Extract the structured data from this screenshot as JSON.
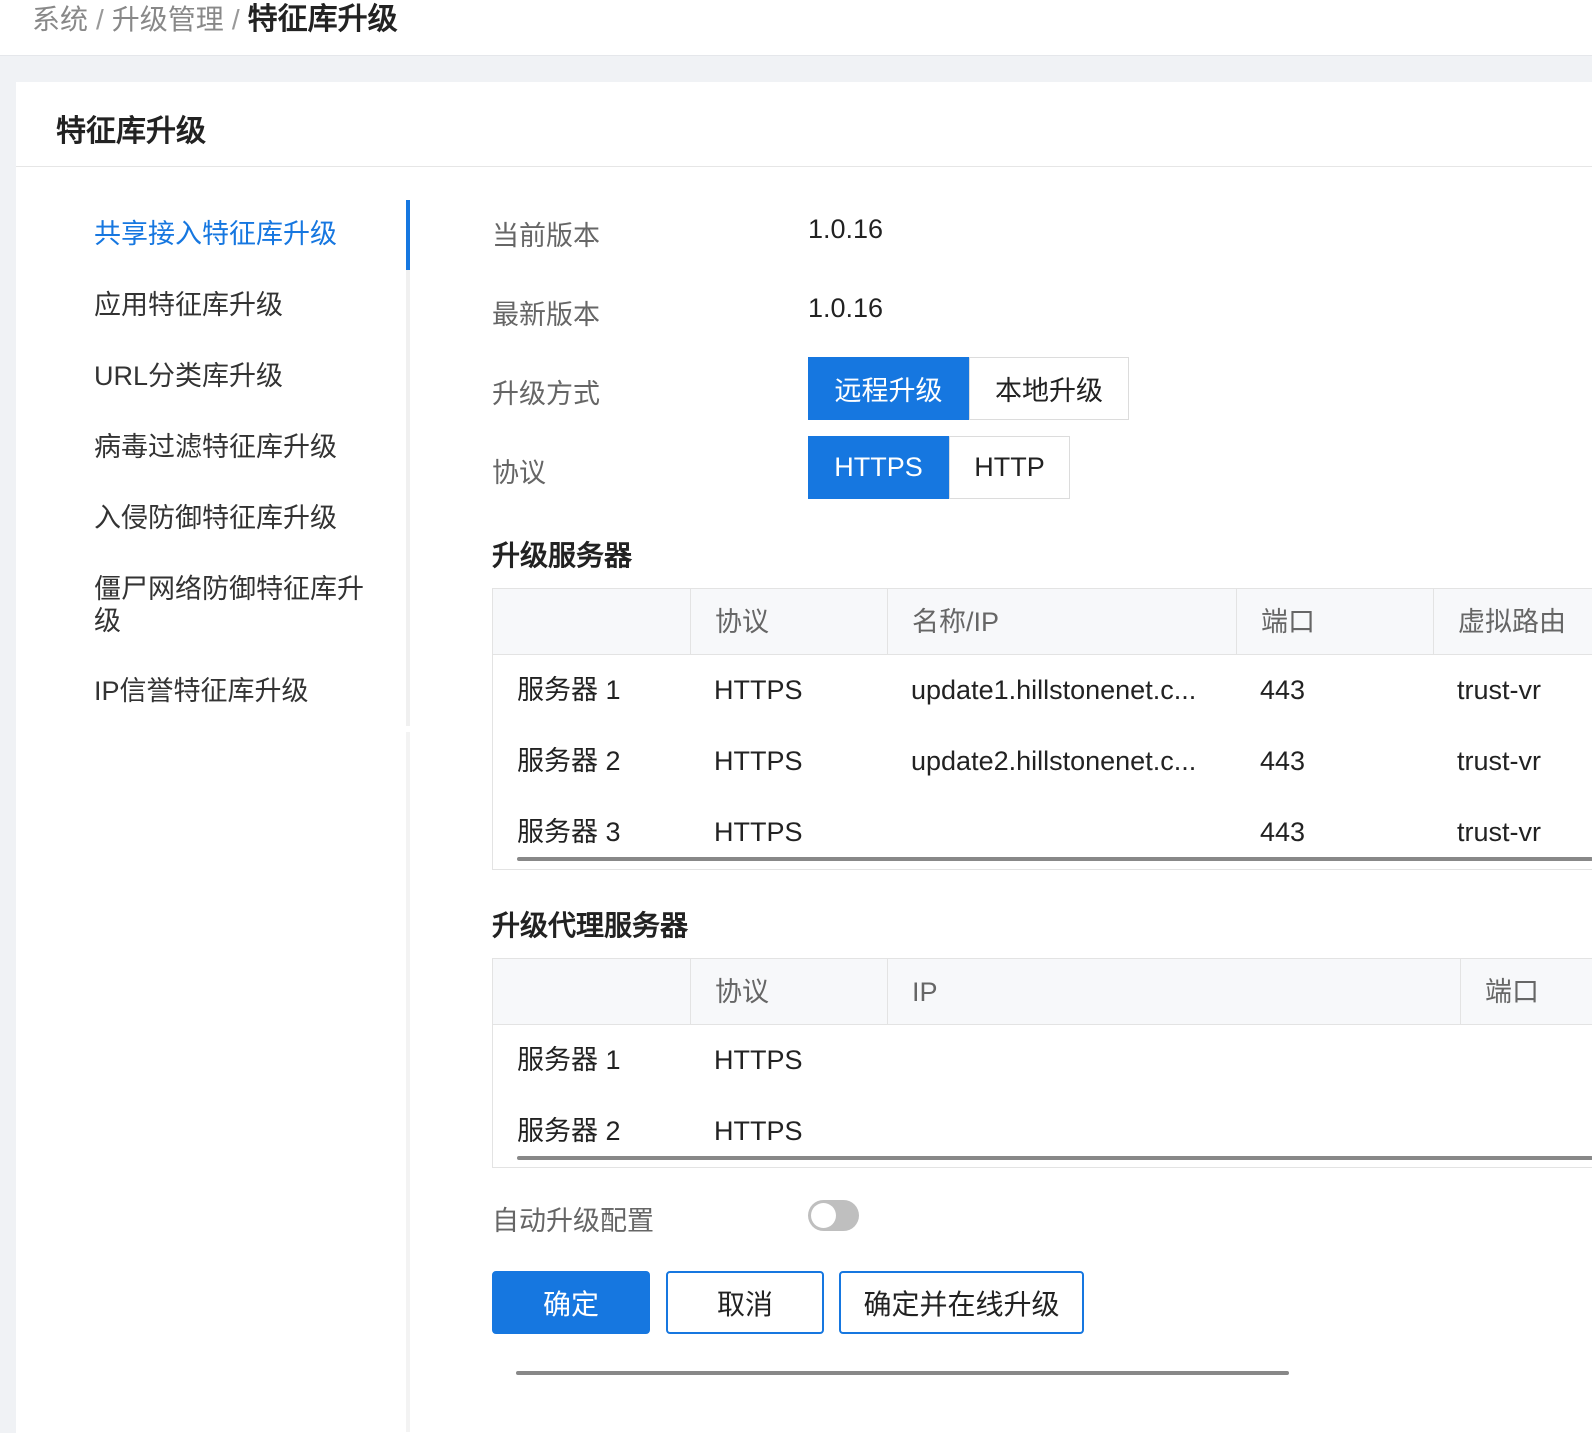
{
  "breadcrumb": {
    "items": [
      "系统",
      "升级管理"
    ],
    "separator": "/",
    "current": "特征库升级"
  },
  "card": {
    "title": "特征库升级"
  },
  "nav": {
    "items": [
      {
        "label": "共享接入特征库升级",
        "active": true
      },
      {
        "label": "应用特征库升级"
      },
      {
        "label": "URL分类库升级"
      },
      {
        "label": "病毒过滤特征库升级"
      },
      {
        "label": "入侵防御特征库升级"
      },
      {
        "label": "僵尸网络防御特征库升级"
      },
      {
        "label": "IP信誉特征库升级"
      }
    ]
  },
  "form": {
    "current_version_label": "当前版本",
    "current_version": "1.0.16",
    "latest_version_label": "最新版本",
    "latest_version": "1.0.16",
    "upgrade_mode_label": "升级方式",
    "upgrade_mode_options": [
      "远程升级",
      "本地升级"
    ],
    "upgrade_mode_selected": "远程升级",
    "protocol_label": "协议",
    "protocol_options": [
      "HTTPS",
      "HTTP"
    ],
    "protocol_selected": "HTTPS"
  },
  "upgrade_servers": {
    "title": "升级服务器",
    "columns": [
      "",
      "协议",
      "名称/IP",
      "端口",
      "虚拟路由"
    ],
    "rows": [
      {
        "name": "服务器 1",
        "protocol": "HTTPS",
        "host": "update1.hillstonenet.c...",
        "port": "443",
        "vr": "trust-vr"
      },
      {
        "name": "服务器 2",
        "protocol": "HTTPS",
        "host": "update2.hillstonenet.c...",
        "port": "443",
        "vr": "trust-vr"
      },
      {
        "name": "服务器 3",
        "protocol": "HTTPS",
        "host": "",
        "port": "443",
        "vr": "trust-vr"
      }
    ]
  },
  "proxy_servers": {
    "title": "升级代理服务器",
    "columns": [
      "",
      "协议",
      "IP",
      "端口"
    ],
    "rows": [
      {
        "name": "服务器 1",
        "protocol": "HTTPS"
      },
      {
        "name": "服务器 2",
        "protocol": "HTTPS"
      }
    ]
  },
  "auto_upgrade": {
    "label": "自动升级配置",
    "enabled": false
  },
  "buttons": {
    "confirm": "确定",
    "cancel": "取消",
    "confirm_and_upgrade": "确定并在线升级"
  },
  "colors": {
    "accent": "#1677e0",
    "toggle_off": "#bfbfbf"
  }
}
